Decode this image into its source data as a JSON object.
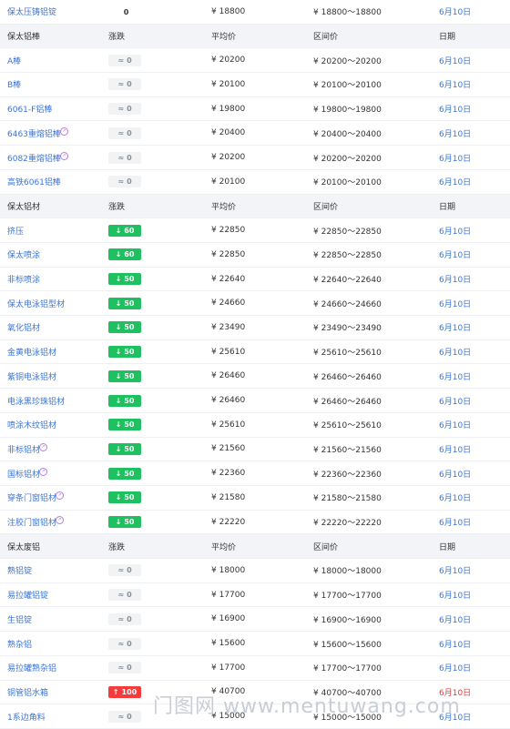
{
  "top_row": {
    "name": "保太压铸铝锭",
    "change": "0",
    "avg": "¥ 18800",
    "range": "¥ 18800～18800",
    "date": "6月10日"
  },
  "sections": [
    {
      "title": "保太铝棒",
      "cols": [
        "涨跌",
        "平均价",
        "区间价",
        "日期"
      ],
      "rows": [
        {
          "name": "A棒",
          "change": "0",
          "dir": "flat",
          "avg": "¥ 20200",
          "range": "¥ 20200～20200",
          "date": "6月10日"
        },
        {
          "name": "B棒",
          "change": "0",
          "dir": "flat",
          "avg": "¥ 20100",
          "range": "¥ 20100～20100",
          "date": "6月10日"
        },
        {
          "name": "6061-F铝棒",
          "change": "0",
          "dir": "flat",
          "avg": "¥ 19800",
          "range": "¥ 19800～19800",
          "date": "6月10日"
        },
        {
          "name": "6463重熔铝棒",
          "tag": true,
          "change": "0",
          "dir": "flat",
          "avg": "¥ 20400",
          "range": "¥ 20400～20400",
          "date": "6月10日"
        },
        {
          "name": "6082重熔铝棒",
          "tag": true,
          "change": "0",
          "dir": "flat",
          "avg": "¥ 20200",
          "range": "¥ 20200～20200",
          "date": "6月10日"
        },
        {
          "name": "高铁6061铝棒",
          "change": "0",
          "dir": "flat",
          "avg": "¥ 20100",
          "range": "¥ 20100～20100",
          "date": "6月10日"
        }
      ]
    },
    {
      "title": "保太铝材",
      "cols": [
        "涨跌",
        "平均价",
        "区间价",
        "日期"
      ],
      "rows": [
        {
          "name": "挤压",
          "change": "60",
          "dir": "down",
          "avg": "¥ 22850",
          "range": "¥ 22850～22850",
          "date": "6月10日"
        },
        {
          "name": "保太喷涂",
          "change": "60",
          "dir": "down",
          "avg": "¥ 22850",
          "range": "¥ 22850～22850",
          "date": "6月10日"
        },
        {
          "name": "非标喷涂",
          "change": "50",
          "dir": "down",
          "avg": "¥ 22640",
          "range": "¥ 22640～22640",
          "date": "6月10日"
        },
        {
          "name": "保太电泳铝型材",
          "change": "50",
          "dir": "down",
          "avg": "¥ 24660",
          "range": "¥ 24660～24660",
          "date": "6月10日"
        },
        {
          "name": "氧化铝材",
          "change": "50",
          "dir": "down",
          "avg": "¥ 23490",
          "range": "¥ 23490～23490",
          "date": "6月10日"
        },
        {
          "name": "金黄电泳铝材",
          "change": "50",
          "dir": "down",
          "avg": "¥ 25610",
          "range": "¥ 25610～25610",
          "date": "6月10日"
        },
        {
          "name": "紫铜电泳铝材",
          "change": "50",
          "dir": "down",
          "avg": "¥ 26460",
          "range": "¥ 26460～26460",
          "date": "6月10日"
        },
        {
          "name": "电泳黑珍珠铝材",
          "change": "50",
          "dir": "down",
          "avg": "¥ 26460",
          "range": "¥ 26460～26460",
          "date": "6月10日"
        },
        {
          "name": "喷涂木纹铝材",
          "change": "50",
          "dir": "down",
          "avg": "¥ 25610",
          "range": "¥ 25610～25610",
          "date": "6月10日"
        },
        {
          "name": "非标铝材",
          "tag": true,
          "change": "50",
          "dir": "down",
          "avg": "¥ 21560",
          "range": "¥ 21560～21560",
          "date": "6月10日"
        },
        {
          "name": "国标铝材",
          "tag": true,
          "change": "50",
          "dir": "down",
          "avg": "¥ 22360",
          "range": "¥ 22360～22360",
          "date": "6月10日"
        },
        {
          "name": "穿条门窗铝材",
          "tag": true,
          "change": "50",
          "dir": "down",
          "avg": "¥ 21580",
          "range": "¥ 21580～21580",
          "date": "6月10日"
        },
        {
          "name": "注胶门窗铝材",
          "tag": true,
          "change": "50",
          "dir": "down",
          "avg": "¥ 22220",
          "range": "¥ 22220～22220",
          "date": "6月10日"
        }
      ]
    },
    {
      "title": "保太废铝",
      "cols": [
        "涨跌",
        "平均价",
        "区间价",
        "日期"
      ],
      "rows": [
        {
          "name": "熟铝锭",
          "change": "0",
          "dir": "flat",
          "avg": "¥ 18000",
          "range": "¥ 18000～18000",
          "date": "6月10日"
        },
        {
          "name": "易拉罐铝锭",
          "change": "0",
          "dir": "flat",
          "avg": "¥ 17700",
          "range": "¥ 17700～17700",
          "date": "6月10日"
        },
        {
          "name": "生铝锭",
          "change": "0",
          "dir": "flat",
          "avg": "¥ 16900",
          "range": "¥ 16900～16900",
          "date": "6月10日"
        },
        {
          "name": "熟杂铝",
          "change": "0",
          "dir": "flat",
          "avg": "¥ 15600",
          "range": "¥ 15600～15600",
          "date": "6月10日"
        },
        {
          "name": "易拉罐熟杂铝",
          "change": "0",
          "dir": "flat",
          "avg": "¥ 17700",
          "range": "¥ 17700～17700",
          "date": "6月10日"
        },
        {
          "name": "铜管铝水箱",
          "change": "100",
          "dir": "up",
          "avg": "¥ 40700",
          "range": "¥ 40700～40700",
          "date": "6月10日"
        },
        {
          "name": "1系边角料",
          "change": "0",
          "dir": "flat",
          "avg": "¥ 15000",
          "range": "¥ 15000～15000",
          "date": "6月10日"
        }
      ]
    }
  ],
  "icons": {
    "flat": "≈",
    "down": "↓",
    "up": "↑"
  },
  "colors": {
    "link": "#3b74d6",
    "down": "#1ec05f",
    "up": "#f53b3b",
    "date_up": "#e23b3b",
    "header_bg": "#f2f4f8"
  },
  "watermark": "门图网 www.mentuwang.com"
}
